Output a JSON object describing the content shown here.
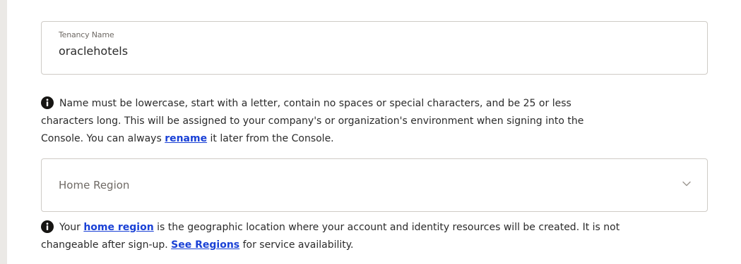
{
  "tenancy": {
    "label": "Tenancy Name",
    "value": "oraclehotels",
    "help": {
      "line1": "Name must be lowercase, start with a letter, contain no spaces or special characters, and be 25 or less",
      "line2": "characters long. This will be assigned to your company's or organization's environment when signing into the",
      "line3_before": "Console. You can always ",
      "rename_link": "rename",
      "line3_after": " it later from the Console."
    }
  },
  "home_region": {
    "placeholder": "Home Region",
    "help": {
      "before": "Your ",
      "home_region_link": "home region",
      "middle": " is the geographic location where your account and identity resources will be created. It is not",
      "line2_before": "changeable after sign-up. ",
      "see_regions_link": "See Regions",
      "line2_after": " for service availability."
    }
  },
  "icons": {
    "info": "info-icon",
    "dropdown": "chevron-down-icon"
  }
}
